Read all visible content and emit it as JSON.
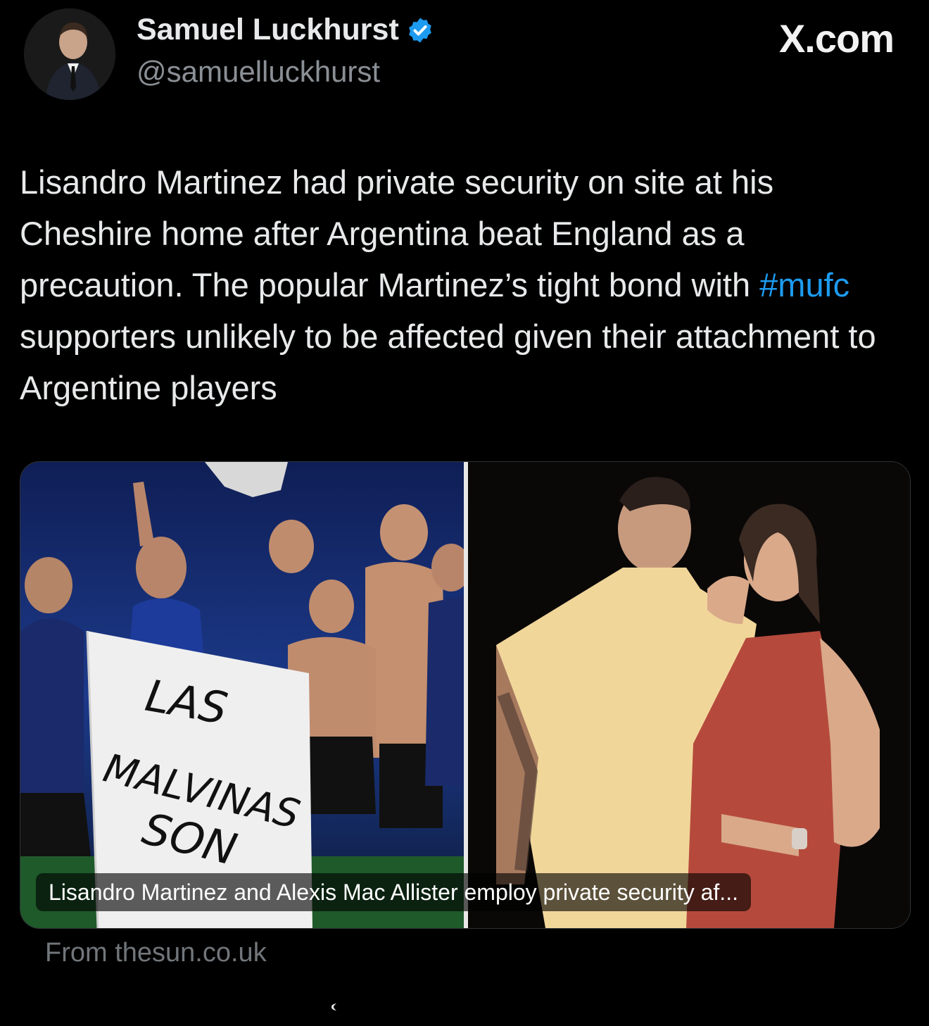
{
  "header": {
    "author_name": "Samuel Luckhurst",
    "author_handle": "@samuelluckhurst",
    "verified": true,
    "site_label": "X.com"
  },
  "tweet": {
    "text_before_hashtag": "Lisandro Martinez had private security on site at his Cheshire home after Argentina beat England as a precaution. The popular Martinez’s tight bond with ",
    "hashtag": "#mufc",
    "text_after_hashtag": " supporters unlikely to be affected given their attachment to Argentine players"
  },
  "card": {
    "caption": "Lisandro Martinez and Alexis Mac Allister employ private security af...",
    "banner_text": [
      "LAS",
      "MALVINAS",
      "SON"
    ],
    "source": "From thesun.co.uk"
  },
  "colors": {
    "background": "#000000",
    "text": "#e7e9ea",
    "secondary_text": "#71767b",
    "hashtag": "#1d9bf0",
    "verified_badge": "#1d9bf0"
  },
  "icons": {
    "verified": "verified-badge-icon",
    "avatar": "profile-avatar"
  }
}
